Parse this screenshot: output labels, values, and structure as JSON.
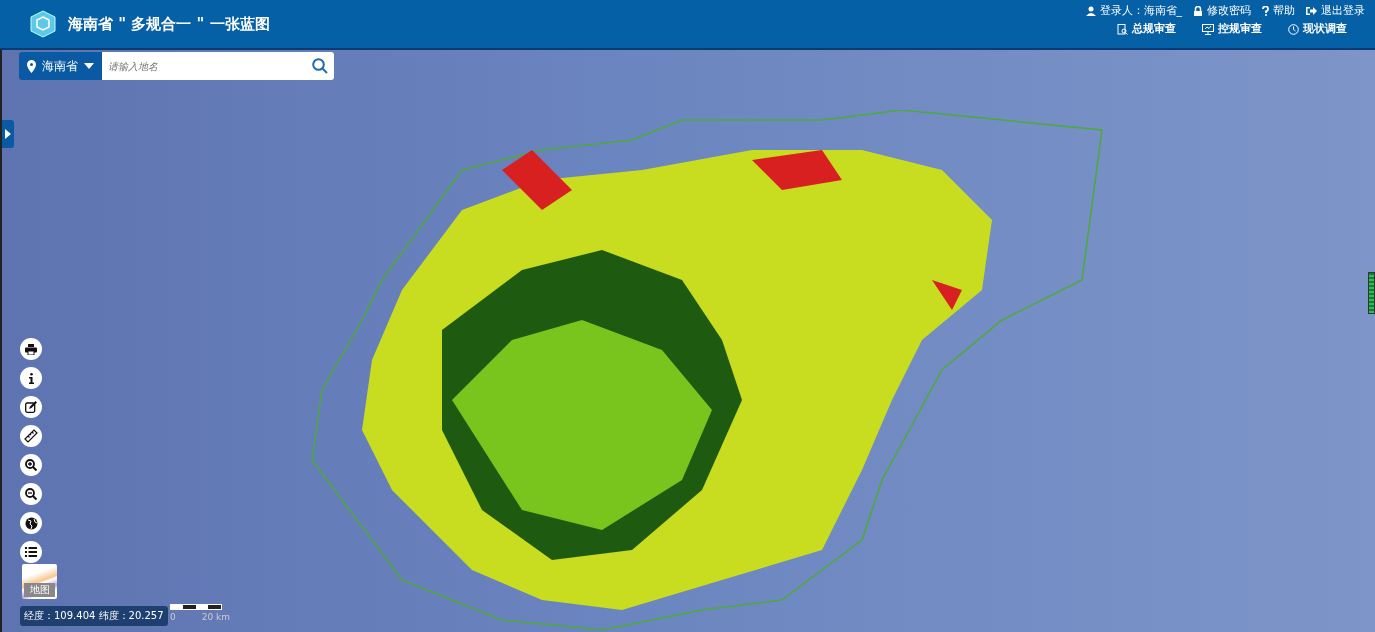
{
  "header": {
    "title": "海南省 \" 多规合一 \" 一张蓝图",
    "user_menu": [
      {
        "kind": "user",
        "label": "登录人：海南省_"
      },
      {
        "kind": "lock",
        "label": "修改密码"
      },
      {
        "kind": "help",
        "label": "帮助"
      },
      {
        "kind": "logout",
        "label": "退出登录"
      }
    ],
    "nav": [
      {
        "kind": "review",
        "label": "总规审查"
      },
      {
        "kind": "monitor",
        "label": "控规审查"
      },
      {
        "kind": "clock",
        "label": "现状调查"
      }
    ]
  },
  "search": {
    "region": "海南省",
    "placeholder": "请输入地名"
  },
  "tools": [
    {
      "kind": "print"
    },
    {
      "kind": "info"
    },
    {
      "kind": "edit"
    },
    {
      "kind": "measure"
    },
    {
      "kind": "zoom-in"
    },
    {
      "kind": "zoom-out"
    },
    {
      "kind": "globe"
    },
    {
      "kind": "layers"
    }
  ],
  "basemap": {
    "label": "地图"
  },
  "coordinates": "经度：109.404 纬度：20.257",
  "scale": {
    "start": "0",
    "end": "20 km"
  }
}
